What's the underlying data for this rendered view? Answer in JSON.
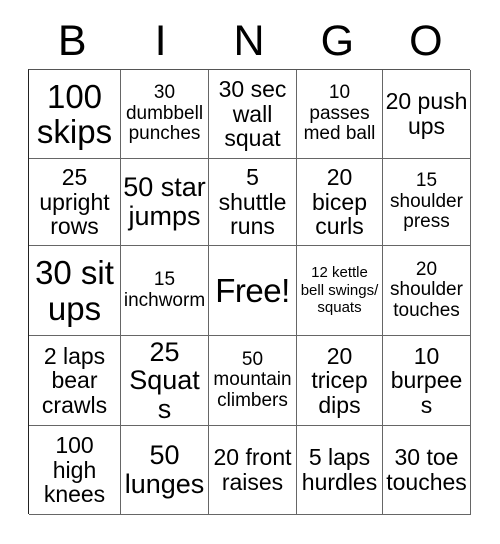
{
  "card": {
    "title_letters": [
      "B",
      "I",
      "N",
      "G",
      "O"
    ],
    "free_space_label": "Free!",
    "text_color": "#000000",
    "grid_line_color": "#666666",
    "background_color": "#ffffff"
  },
  "grid": {
    "columns": 5,
    "rows": 5,
    "cells": [
      [
        {
          "text": "100 skips",
          "size": "xl"
        },
        {
          "text": "30 dumbbell punches",
          "size": "sm"
        },
        {
          "text": "30 sec wall squat",
          "size": "md"
        },
        {
          "text": "10 passes med ball",
          "size": "sm"
        },
        {
          "text": "20 push ups",
          "size": "md"
        }
      ],
      [
        {
          "text": "25 upright rows",
          "size": "md"
        },
        {
          "text": "50 star jumps",
          "size": "lg"
        },
        {
          "text": "5 shuttle runs",
          "size": "md"
        },
        {
          "text": "20 bicep curls",
          "size": "md"
        },
        {
          "text": "15 shoulder press",
          "size": "sm"
        }
      ],
      [
        {
          "text": "30 sit ups",
          "size": "xl"
        },
        {
          "text": "15 inchworm",
          "size": "sm"
        },
        {
          "text": "Free!",
          "size": "xl"
        },
        {
          "text": "12 kettle bell swings/ squats",
          "size": "xs"
        },
        {
          "text": "20 shoulder touches",
          "size": "sm"
        }
      ],
      [
        {
          "text": "2 laps bear crawls",
          "size": "md"
        },
        {
          "text": "25 Squats",
          "size": "lg"
        },
        {
          "text": "50 mountain climbers",
          "size": "sm"
        },
        {
          "text": "20 tricep dips",
          "size": "md"
        },
        {
          "text": "10 burpees",
          "size": "md"
        }
      ],
      [
        {
          "text": "100 high knees",
          "size": "md"
        },
        {
          "text": "50 lunges",
          "size": "lg"
        },
        {
          "text": "20 front raises",
          "size": "md"
        },
        {
          "text": "5 laps hurdles",
          "size": "md"
        },
        {
          "text": "30 toe touches",
          "size": "md"
        }
      ]
    ]
  }
}
